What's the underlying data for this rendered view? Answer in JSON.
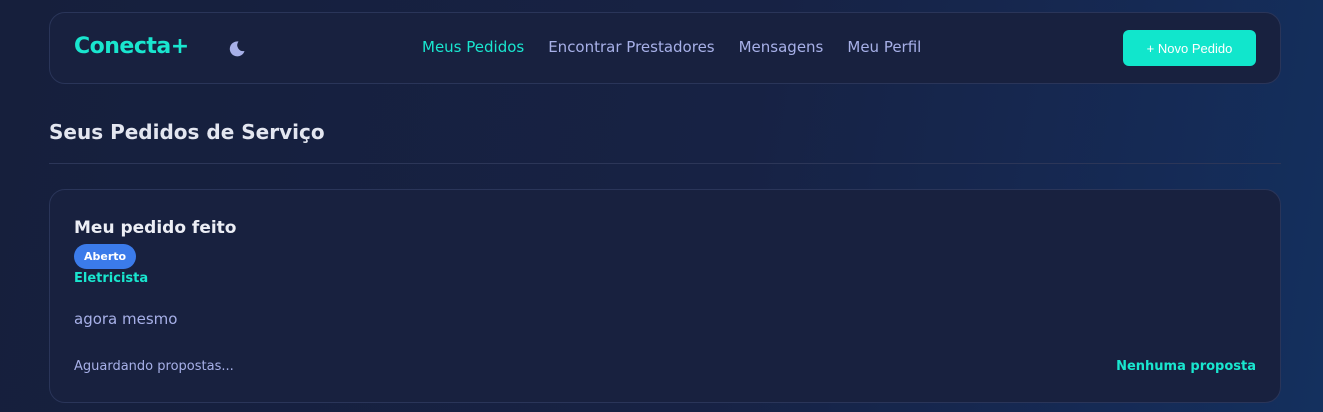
{
  "header": {
    "logo": "Conecta+",
    "theme_icon": "moon-icon",
    "nav": [
      {
        "label": "Meus Pedidos",
        "active": true
      },
      {
        "label": "Encontrar Prestadores",
        "active": false
      },
      {
        "label": "Mensagens",
        "active": false
      },
      {
        "label": "Meu Perfil",
        "active": false
      }
    ],
    "new_order_label": "+ Novo Pedido"
  },
  "main": {
    "title": "Seus Pedidos de Serviço",
    "orders": [
      {
        "title": "Meu pedido feito",
        "status_badge": "Aberto",
        "category": "Eletricista",
        "time": "agora mesmo",
        "status_text": "Aguardando propostas...",
        "proposals_text": "Nenhuma proposta"
      }
    ]
  },
  "colors": {
    "accent": "#19e6cf",
    "badge": "#3b7bea",
    "background": "#161f3c",
    "card": "#18213f",
    "muted_text": "#a7b0e8"
  }
}
